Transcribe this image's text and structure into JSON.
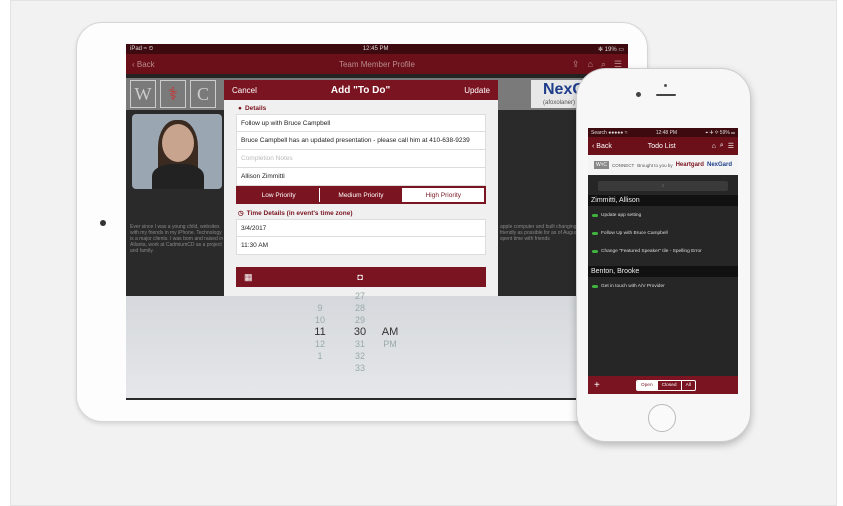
{
  "ipad": {
    "status": {
      "carrier": "iPad ≈ ⏲",
      "time": "12:45 PM",
      "battery": "✻ 19% ▭"
    },
    "nav": {
      "back": "‹ Back",
      "title": "Team Member Profile"
    },
    "banner": {
      "letter": "W",
      "letter2": "C",
      "logo": "NexGard",
      "logo_sub": "(afoxolaner) Chewables"
    },
    "bio_left": "Ever since I was a young child, websites with my friends in my iPhone. Technology is a major clients. I was born and raised in Atlanta, work at CadmiumCD as a project and family.",
    "bio_right": "apple computer and built changing apps on my over friendly as possible for as of August 2014, when and spent time with friends",
    "modal": {
      "cancel": "Cancel",
      "title": "Add \"To Do\"",
      "update": "Update",
      "details_label": "Details",
      "fields": [
        "Follow up with Bruce Campbell",
        "Bruce Campbell has an updated presentation - please call him at 410-638-9239"
      ],
      "notes_placeholder": "Completion Notes",
      "assignee": "Allison Zimmitti",
      "priorities": [
        "Low Priority",
        "Medium Priority",
        "High Priority"
      ],
      "time_label": "Time Details (in event's time zone)",
      "date": "3/4/2017",
      "time": "11:30 AM"
    },
    "picker": {
      "hours": [
        "9",
        "10",
        "11",
        "12",
        "1"
      ],
      "minutes": [
        "27",
        "28",
        "29",
        "30",
        "31",
        "32",
        "33"
      ],
      "ampm": [
        "AM",
        "PM"
      ]
    }
  },
  "iphone": {
    "status": {
      "carrier": "Search ●●●●● ≈",
      "time": "12:48 PM",
      "battery": "⌖ ✈ ✻ 59% ▭"
    },
    "nav": {
      "back": "‹ Back",
      "title": "Todo List"
    },
    "logos": {
      "connect": "CONNECT",
      "brought": "Brought to you by",
      "heartgard": "Heartgard",
      "nexgard": "NexGard"
    },
    "groups": [
      {
        "name": "Zimmitti, Allison",
        "items": [
          "Update app setting",
          "Follow Up with Bruce Campbell",
          "Change \"Featured Speaker\" tile - Spelling Error"
        ]
      },
      {
        "name": "Benton, Brooke",
        "items": [
          "Get in touch with A/V Provider"
        ]
      }
    ],
    "footer": {
      "add": "+",
      "tabs": [
        "Open",
        "Closed",
        "All"
      ]
    }
  },
  "colors": {
    "maroon": "#7a1420",
    "dark_maroon": "#3d0a0f",
    "check_green": "#3fb23f"
  }
}
